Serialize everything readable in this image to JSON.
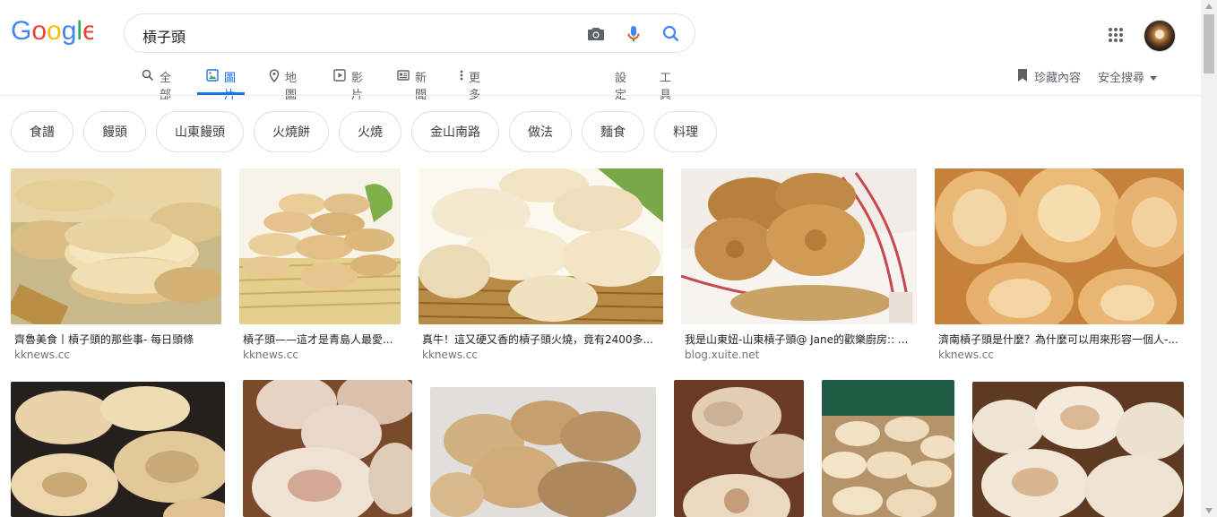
{
  "search": {
    "query": "槓子頭"
  },
  "tabs": [
    {
      "label": "全部"
    },
    {
      "label": "圖片"
    },
    {
      "label": "地圖"
    },
    {
      "label": "影片"
    },
    {
      "label": "新聞"
    },
    {
      "label": "更多"
    }
  ],
  "tools": {
    "settings": "設定",
    "tools": "工具"
  },
  "right": {
    "saved": "珍藏內容",
    "safesearch": "安全搜尋"
  },
  "chips": [
    "食譜",
    "饅頭",
    "山東饅頭",
    "火燒餅",
    "火燒",
    "金山南路",
    "做法",
    "麵食",
    "料理"
  ],
  "results_row1": [
    {
      "title": "齊魯美食丨槓子頭的那些事- 每日頭條",
      "source": "kknews.cc"
    },
    {
      "title": "槓子頭——這才是青島人最愛...",
      "source": "kknews.cc"
    },
    {
      "title": "真牛！這又硬又香的槓子頭火燒，竟有2400多...",
      "source": "kknews.cc"
    },
    {
      "title": "我是山東妞-山東槓子頭@ Jane的歡樂廚房:: ...",
      "source": "blog.xuite.net"
    },
    {
      "title": "濟南槓子頭是什麼？為什麼可以用來形容一個人-...",
      "source": "kknews.cc"
    }
  ]
}
